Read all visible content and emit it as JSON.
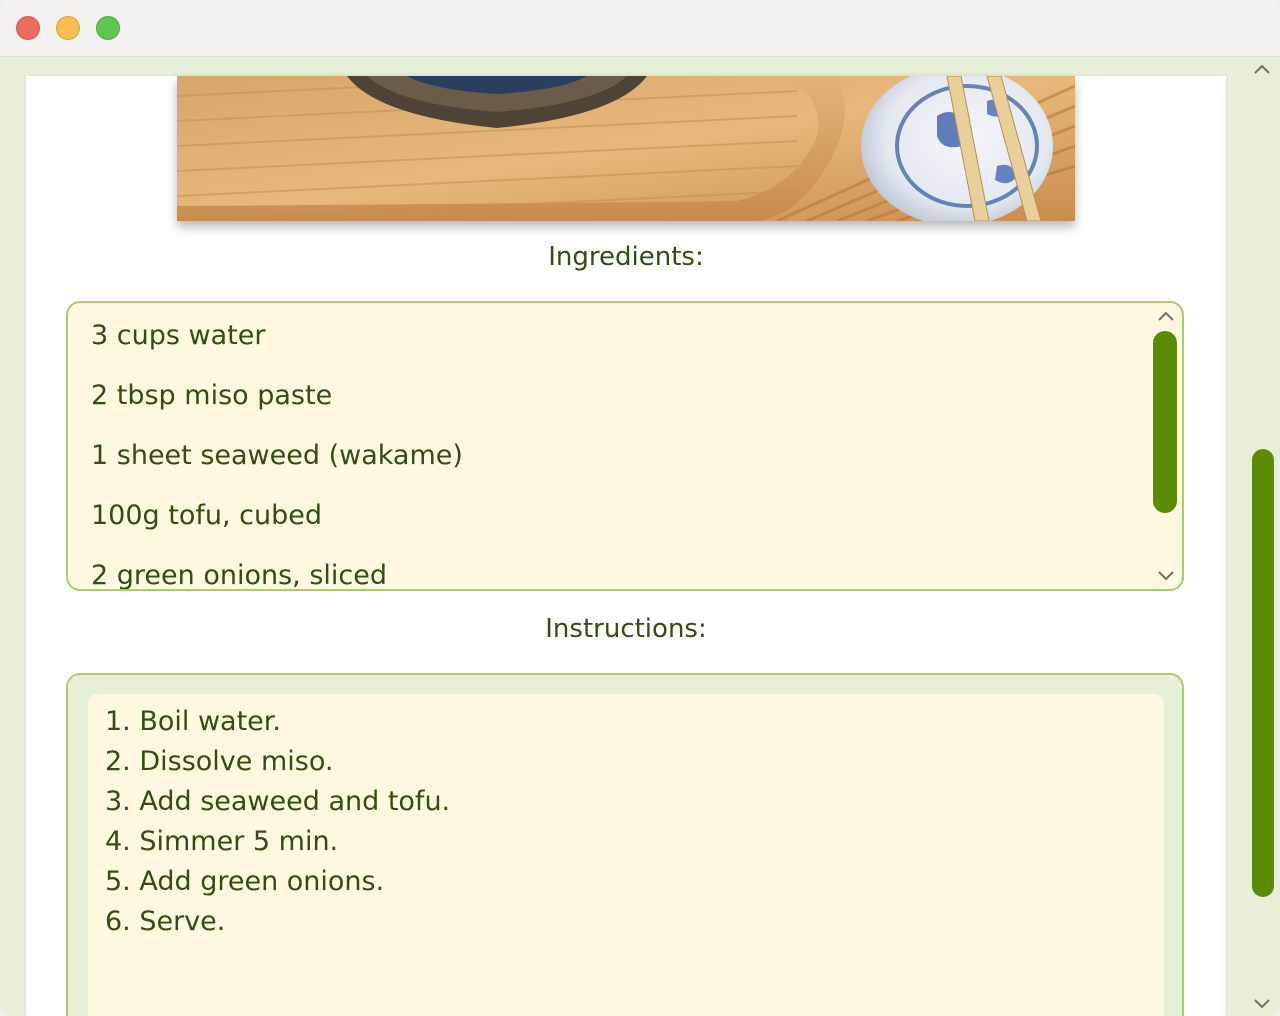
{
  "window": {
    "controls": {
      "close": "close-button",
      "minimize": "minimize-button",
      "maximize": "maximize-button"
    },
    "colors": {
      "close": "#ed6a5e",
      "minimize": "#f5be4f",
      "maximize": "#62c554"
    }
  },
  "recipe": {
    "image_alt": "Miso soup bowl with chopsticks on bamboo board",
    "ingredients_title": "Ingredients:",
    "ingredients": [
      "3 cups water",
      "2 tbsp miso paste",
      "1 sheet seaweed (wakame)",
      "100g tofu, cubed",
      "2 green onions, sliced"
    ],
    "instructions_title": "Instructions:",
    "instructions": [
      "1. Boil water.",
      "2. Dissolve miso.",
      "3. Add seaweed and tofu.",
      "4. Simmer 5 min.",
      "5. Add green onions.",
      "6. Serve."
    ]
  },
  "icons": {
    "scroll_up": "chevron-up-icon",
    "scroll_down": "chevron-down-icon"
  },
  "theme": {
    "accent": "#5b8a06",
    "border": "#a6cf6a",
    "panel_bg": "#fdf8df",
    "page_bg": "#e6f0d8",
    "text": "#2f5010"
  }
}
